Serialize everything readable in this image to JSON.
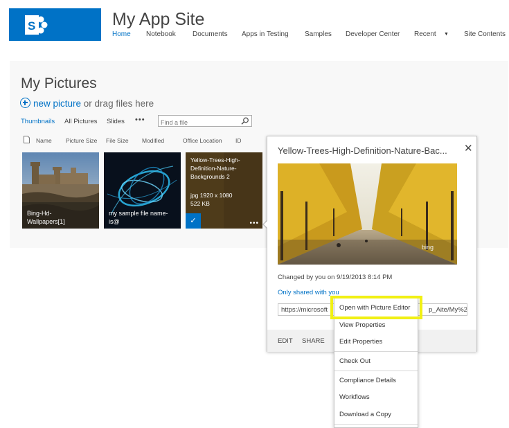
{
  "header": {
    "site_title": "My App Site",
    "nav": [
      "Home",
      "Notebook",
      "Documents",
      "Apps in Testing",
      "Samples",
      "Developer Center",
      "Recent",
      "Site Contents"
    ],
    "active_nav": "Home",
    "logo_icon": "sharepoint-logo-icon"
  },
  "library": {
    "title": "My Pictures",
    "new_link": "new picture",
    "new_rest": " or drag files here",
    "views": [
      "Thumbnails",
      "All Pictures",
      "Slides"
    ],
    "more_views": "•••",
    "search_placeholder": "Find a file",
    "columns": [
      "Name",
      "Picture Size",
      "File Size",
      "Modified",
      "Office Location",
      "ID"
    ]
  },
  "thumbnails": [
    {
      "caption_line1": "Bing-Hd-",
      "caption_line2": "Wallpapers[1]"
    },
    {
      "caption_line1": "my sample file name-",
      "caption_line2": "is@"
    },
    {
      "name_line1": "Yellow-Trees-High-",
      "name_line2": "Definition-Nature-",
      "name_line3": "Backgrounds 2",
      "dimensions": "jpg 1920 x 1080",
      "file_size": "522 KB",
      "check": "✓",
      "more": "•••"
    }
  ],
  "callout": {
    "title": "Yellow-Trees-High-Definition-Nature-Bac...",
    "close": "✕",
    "watermark": "bing",
    "changed": "Changed by you on 9/19/2013 8:14 PM",
    "shared": "Only shared with you",
    "url_start": "https://microsoft",
    "url_end": "p_Aite/My%20P",
    "edit": "EDIT",
    "share": "SHARE"
  },
  "context_menu": {
    "items": [
      "Open with Picture Editor",
      "View Properties",
      "Edit Properties",
      "Check Out",
      "Compliance Details",
      "Workflows",
      "Download a Copy"
    ],
    "highlight_color": "#f1f014"
  },
  "colors": {
    "accent": "#0072c6",
    "text": "#444444"
  }
}
